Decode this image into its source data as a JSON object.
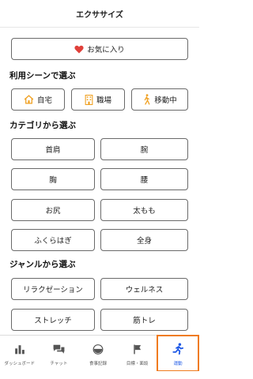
{
  "header": {
    "title": "エクササイズ"
  },
  "favorites": {
    "label": "お気に入り"
  },
  "scenes": {
    "title": "利用シーンで選ぶ",
    "items": [
      {
        "label": "自宅"
      },
      {
        "label": "職場"
      },
      {
        "label": "移動中"
      }
    ]
  },
  "categories": {
    "title": "カテゴリから選ぶ",
    "items": [
      {
        "label": "首肩"
      },
      {
        "label": "腕"
      },
      {
        "label": "胸"
      },
      {
        "label": "腰"
      },
      {
        "label": "お尻"
      },
      {
        "label": "太もも"
      },
      {
        "label": "ふくらはぎ"
      },
      {
        "label": "全身"
      }
    ]
  },
  "genres": {
    "title": "ジャンルから選ぶ",
    "items": [
      {
        "label": "リラクゼーション"
      },
      {
        "label": "ウェルネス"
      },
      {
        "label": "ストレッチ"
      },
      {
        "label": "筋トレ"
      }
    ]
  },
  "tabbar": {
    "items": [
      {
        "label": "ダッシュボード",
        "icon": "bar-chart-icon"
      },
      {
        "label": "チャット",
        "icon": "chat-icon"
      },
      {
        "label": "食事記録",
        "icon": "meal-icon"
      },
      {
        "label": "目標・面談",
        "icon": "flag-icon"
      },
      {
        "label": "運動",
        "icon": "running-icon"
      }
    ]
  },
  "colors": {
    "heart": "#e0403a",
    "scene_icon": "#f0a020",
    "active_tab": "#1d58e6",
    "highlight_border": "#f07b1e"
  }
}
